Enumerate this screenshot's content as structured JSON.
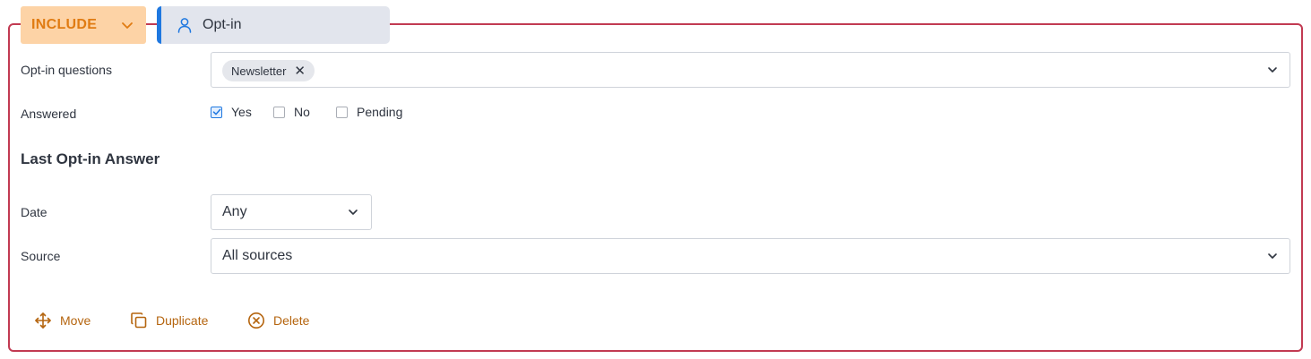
{
  "header": {
    "include_label": "INCLUDE",
    "type_tag_label": "Opt-in"
  },
  "optin_questions": {
    "label": "Opt-in questions",
    "selected": [
      "Newsletter"
    ],
    "chip_remove": "✕"
  },
  "answered": {
    "label": "Answered",
    "options": [
      {
        "label": "Yes",
        "checked": true
      },
      {
        "label": "No",
        "checked": false
      },
      {
        "label": "Pending",
        "checked": false
      }
    ]
  },
  "last_answer": {
    "title": "Last Opt-in Answer",
    "date_label": "Date",
    "date_value": "Any",
    "source_label": "Source",
    "source_value": "All sources"
  },
  "actions": {
    "move": "Move",
    "duplicate": "Duplicate",
    "delete": "Delete"
  },
  "colors": {
    "accent_orange": "#e07b12",
    "action_brown": "#b5650f",
    "border_red": "#c23a52",
    "tag_blue": "#1f78e0"
  }
}
